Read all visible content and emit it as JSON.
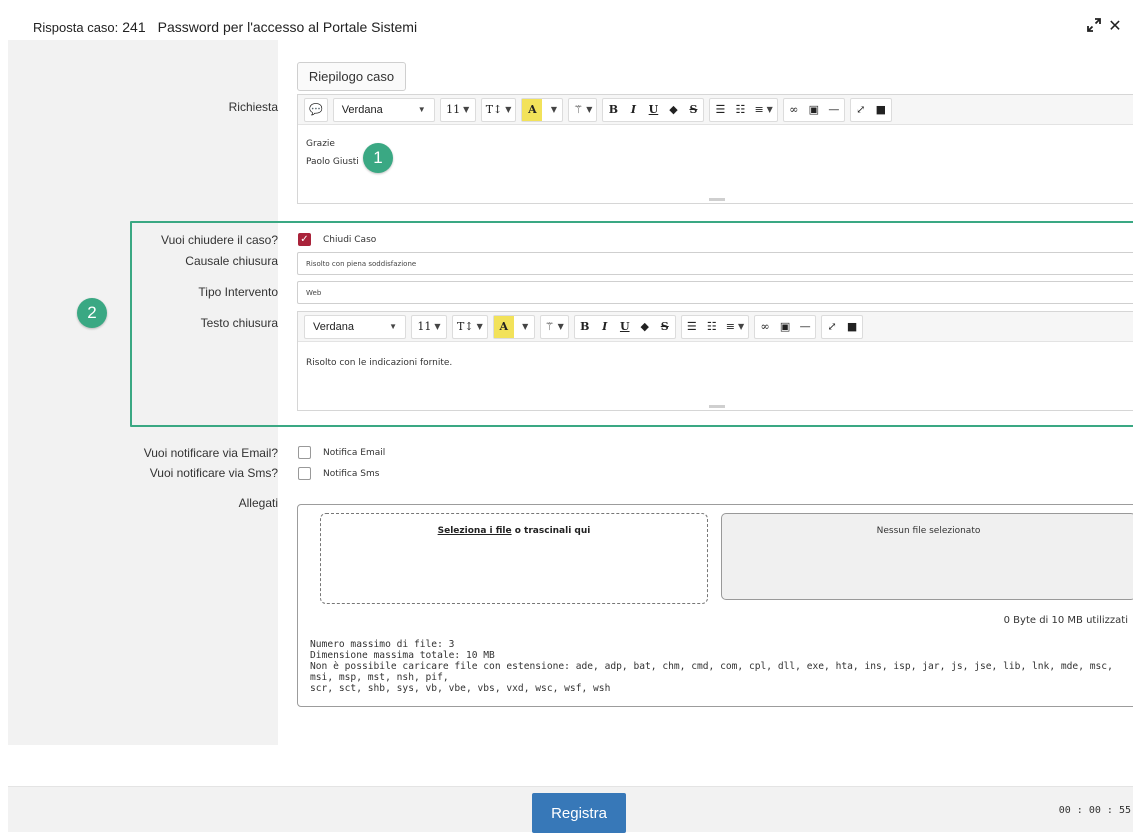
{
  "header": {
    "case_label": "Risposta caso:",
    "case_number": "241",
    "subject": "Password per l'accesso al Portale Sistemi"
  },
  "summary_button": "Riepilogo caso",
  "request": {
    "label": "Richiesta",
    "editor": {
      "font": "Verdana",
      "size": "11",
      "content": [
        "Grazie",
        "Paolo Giusti"
      ]
    }
  },
  "close_section": {
    "close_question": "Vuoi chiudere il caso?",
    "close_checkbox_label": "Chiudi Caso",
    "close_checked": true,
    "reason_label": "Causale chiusura",
    "reason_value": "Risolto con piena soddisfazione",
    "intervention_label": "Tipo Intervento",
    "intervention_value": "Web",
    "text_label": "Testo chiusura",
    "editor": {
      "font": "Verdana",
      "size": "11",
      "content": "Risolto con le indicazioni fornite."
    }
  },
  "notifications": {
    "email_question": "Vuoi notificare via Email?",
    "email_label": "Notifica Email",
    "sms_question": "Vuoi notificare via Sms?",
    "sms_label": "Notifica Sms"
  },
  "attachments": {
    "label": "Allegati",
    "dropzone_link": "Seleziona i file",
    "dropzone_text": " o trascinali qui",
    "status": "Nessun file selezionato",
    "usage": "0 Byte di 10 MB utilizzati",
    "info": [
      "Numero massimo di file: 3",
      "Dimensione massima totale: 10 MB",
      "Non è possibile caricare file con estensione: ade, adp, bat, chm, cmd, com, cpl, dll, exe, hta, ins, isp, jar, js, jse, lib, lnk, mde, msc, msi, msp, mst, nsh, pif,",
      "scr, sct, shb, sys, vb, vbe, vbs, vxd, wsc, wsf, wsh"
    ]
  },
  "badges": {
    "one": "1",
    "two": "2"
  },
  "footer": {
    "save_label": "Registra",
    "timer": "00 : 00 : 55"
  },
  "colors": {
    "accent_green": "#3aa883",
    "save_blue": "#3778b8",
    "checkbox_red": "#a9233a",
    "highlight_yellow": "#f2e25a"
  }
}
